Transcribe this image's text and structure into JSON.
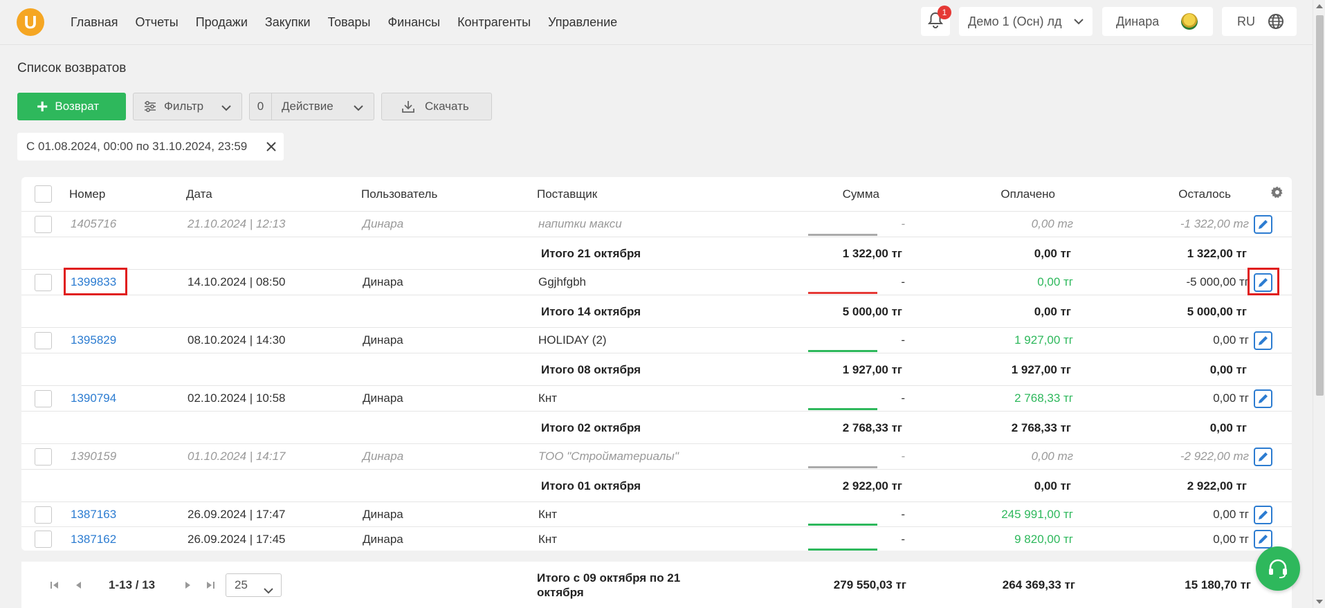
{
  "app": {
    "logo_letter": "U"
  },
  "nav": [
    "Главная",
    "Отчеты",
    "Продажи",
    "Закупки",
    "Товары",
    "Финансы",
    "Контрагенты",
    "Управление"
  ],
  "topbar": {
    "notifications_count": "1",
    "company": "Демо 1 (Осн) лд",
    "user": "Динара",
    "language": "RU"
  },
  "page": {
    "title": "Список возвратов",
    "add_button": "Возврат",
    "filter_button": "Фильтр",
    "action_count": "0",
    "action_button": "Действие",
    "download_button": "Скачать",
    "date_filter": "С 01.08.2024, 00:00 по 31.10.2024, 23:59"
  },
  "table": {
    "headers": {
      "number": "Номер",
      "date": "Дата",
      "user": "Пользователь",
      "supplier": "Поставщик",
      "sum": "Сумма",
      "paid": "Оплачено",
      "remaining": "Осталось"
    },
    "rows": [
      {
        "number": "1405716",
        "date": "21.10.2024 | 12:13",
        "user": "Динара",
        "supplier": "напитки макси",
        "sum": "-",
        "paid": "0,00 тг",
        "remaining": "-1 322,00 тг",
        "status": "draft"
      },
      {
        "total_label": "Итого 21 октября",
        "sum": "1 322,00 тг",
        "paid": "0,00 тг",
        "remaining": "1 322,00 тг"
      },
      {
        "number": "1399833",
        "date": "14.10.2024 | 08:50",
        "user": "Динара",
        "supplier": "Ggjhfgbh",
        "sum": "-",
        "paid": "0,00 тг",
        "remaining": "-5 000,00 тг",
        "status": "unpaid"
      },
      {
        "total_label": "Итого 14 октября",
        "sum": "5 000,00 тг",
        "paid": "0,00 тг",
        "remaining": "5 000,00 тг"
      },
      {
        "number": "1395829",
        "date": "08.10.2024 | 14:30",
        "user": "Динара",
        "supplier": "HOLIDAY (2)",
        "sum": "-",
        "paid": "1 927,00 тг",
        "remaining": "0,00 тг",
        "status": "paid"
      },
      {
        "total_label": "Итого 08 октября",
        "sum": "1 927,00 тг",
        "paid": "1 927,00 тг",
        "remaining": "0,00 тг"
      },
      {
        "number": "1390794",
        "date": "02.10.2024 | 10:58",
        "user": "Динара",
        "supplier": "Кнт",
        "sum": "-",
        "paid": "2 768,33 тг",
        "remaining": "0,00 тг",
        "status": "paid"
      },
      {
        "total_label": "Итого 02 октября",
        "sum": "2 768,33 тг",
        "paid": "2 768,33 тг",
        "remaining": "0,00 тг"
      },
      {
        "number": "1390159",
        "date": "01.10.2024 | 14:17",
        "user": "Динара",
        "supplier": "ТОО \"Стройматериалы\"",
        "sum": "-",
        "paid": "0,00 тг",
        "remaining": "-2 922,00 тг",
        "status": "draft"
      },
      {
        "total_label": "Итого 01 октября",
        "sum": "2 922,00 тг",
        "paid": "0,00 тг",
        "remaining": "2 922,00 тг"
      },
      {
        "number": "1387163",
        "date": "26.09.2024 | 17:47",
        "user": "Динара",
        "supplier": "Кнт",
        "sum": "-",
        "paid": "245 991,00 тг",
        "remaining": "0,00 тг",
        "status": "paid"
      },
      {
        "number": "1387162",
        "date": "26.09.2024 | 17:45",
        "user": "Динара",
        "supplier": "Кнт",
        "sum": "-",
        "paid": "9 820,00 тг",
        "remaining": "0,00 тг",
        "status": "paid"
      }
    ]
  },
  "footer": {
    "pagination": "1-13 / 13",
    "page_size": "25",
    "total_label": "Итого с 09 октября по 21 октября",
    "sum": "279 550,03 тг",
    "paid": "264 369,33 тг",
    "remaining": "15 180,70 тг"
  },
  "colors": {
    "accent_green": "#2eb85c",
    "link_blue": "#2c7cd1",
    "alert_red": "#e53935",
    "logo_orange": "#f5a623"
  },
  "icons": [
    "bell-icon",
    "chevron-down-icon",
    "globe-icon",
    "plus-icon",
    "filter-icon",
    "download-icon",
    "close-icon",
    "gear-icon",
    "edit-icon",
    "first-page-icon",
    "prev-page-icon",
    "next-page-icon",
    "last-page-icon",
    "headset-icon"
  ]
}
